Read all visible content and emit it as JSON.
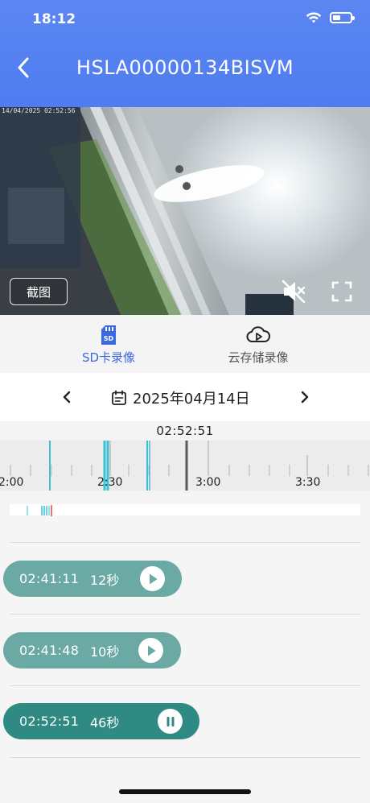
{
  "status_bar": {
    "time": "18:12"
  },
  "header": {
    "title": "HSLA00000134BISVM"
  },
  "video": {
    "osd_text": "14/04/2025 02:52:56",
    "snapshot_label": "截图"
  },
  "tabs": [
    {
      "label": "SD卡录像",
      "icon": "sd-card-icon",
      "active": true
    },
    {
      "label": "云存储录像",
      "icon": "cloud-play-icon",
      "active": false
    }
  ],
  "date_bar": {
    "date": "2025年04月14日"
  },
  "timeline": {
    "cursor_time": "02:52:51",
    "ticks": [
      "2:00",
      "2:30",
      "3:00",
      "3:30"
    ]
  },
  "clips": [
    {
      "start": "02:41:11",
      "duration": "12秒",
      "state": "play"
    },
    {
      "start": "02:41:48",
      "duration": "10秒",
      "state": "play"
    },
    {
      "start": "02:52:51",
      "duration": "46秒",
      "state": "pause"
    }
  ],
  "colors": {
    "header_blue": "#4f7cf0",
    "tab_active": "#3a68e0",
    "clip_teal": "#6aa9a4",
    "clip_active": "#2f8a83",
    "timeline_marker": "#3cc0d4",
    "cursor_red": "#e2463c"
  }
}
